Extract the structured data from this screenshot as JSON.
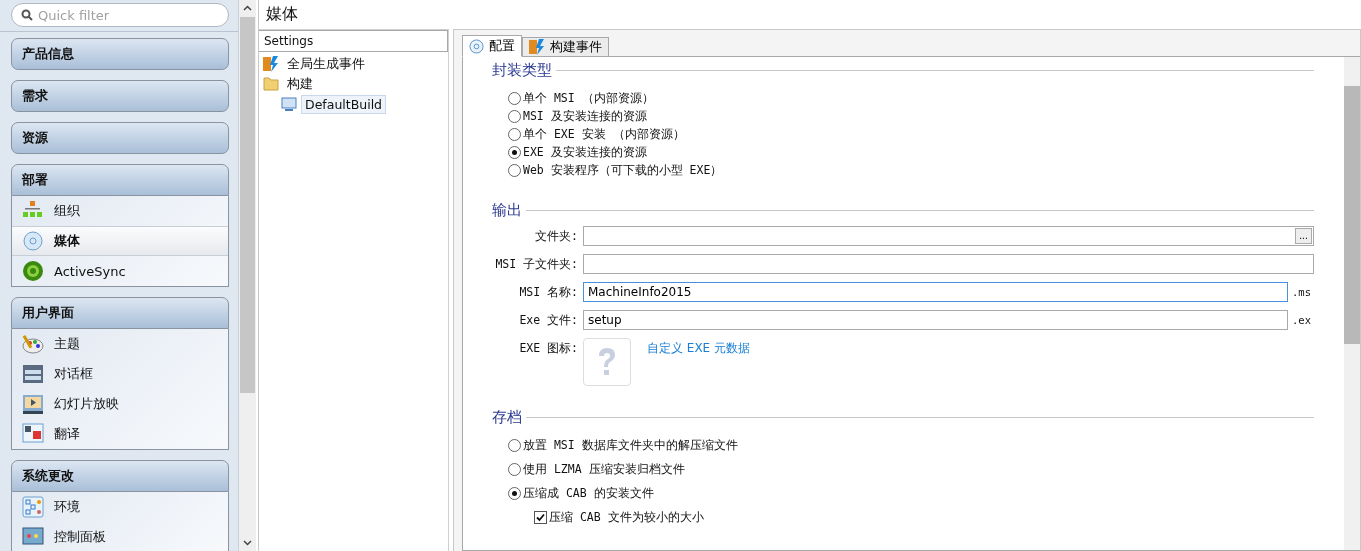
{
  "sidebar": {
    "search": {
      "placeholder": "Quick filter"
    },
    "groups": [
      {
        "title": "产品信息",
        "expanded": false
      },
      {
        "title": "需求",
        "expanded": false
      },
      {
        "title": "资源",
        "expanded": false
      },
      {
        "title": "部署",
        "expanded": true,
        "items": [
          {
            "label": "组织",
            "selected": false
          },
          {
            "label": "媒体",
            "selected": true
          },
          {
            "label": "ActiveSync",
            "selected": false
          }
        ]
      },
      {
        "title": "用户界面",
        "expanded": true,
        "items": [
          {
            "label": "主题",
            "selected": false
          },
          {
            "label": "对话框",
            "selected": false
          },
          {
            "label": "幻灯片放映",
            "selected": false
          },
          {
            "label": "翻译",
            "selected": false
          }
        ]
      },
      {
        "title": "系统更改",
        "expanded": true,
        "items": [
          {
            "label": "环境",
            "selected": false
          },
          {
            "label": "控制面板",
            "selected": false
          }
        ]
      }
    ]
  },
  "page_title": "媒体",
  "settings_tree": {
    "header": "Settings",
    "items": [
      {
        "label": "全局生成事件",
        "selected": false
      },
      {
        "label": "构建",
        "selected": false,
        "children": [
          {
            "label": "DefaultBuild",
            "selected": true
          }
        ]
      }
    ]
  },
  "tabs": [
    {
      "label": "配置",
      "selected": true
    },
    {
      "label": "构建事件",
      "selected": false
    }
  ],
  "sections": [
    {
      "title": "封装类型",
      "kind": "radios",
      "options": [
        {
          "label": "单个 MSI （内部资源）",
          "selected": false
        },
        {
          "label": "MSI 及安装连接的资源",
          "selected": false
        },
        {
          "label": "单个 EXE 安装 （内部资源）",
          "selected": false
        },
        {
          "label": "EXE 及安装连接的资源",
          "selected": true
        },
        {
          "label": "Web 安装程序（可下载的小型 EXE）",
          "selected": false
        }
      ]
    },
    {
      "title": "输出",
      "kind": "fields",
      "fields": [
        {
          "kind": "browse",
          "label": "文件夹:",
          "button": "...",
          "focused": false
        },
        {
          "kind": "text",
          "label": "MSI 子文件夹:",
          "focused": false
        },
        {
          "kind": "text",
          "label": "MSI 名称:",
          "value": "MachineInfo2015",
          "suffix": ".ms",
          "focused": true
        },
        {
          "kind": "text",
          "label": "Exe 文件:",
          "value": "setup",
          "suffix": ".ex",
          "focused": false
        },
        {
          "kind": "icon",
          "label": "EXE 图标:",
          "link": "自定义 EXE 元数据"
        }
      ]
    },
    {
      "title": "存档",
      "kind": "radios",
      "options": [
        {
          "label": "放置 MSI 数据库文件夹中的解压缩文件",
          "selected": false
        },
        {
          "label": "使用 LZMA 压缩安装归档文件",
          "selected": false
        },
        {
          "label": "压缩成 CAB 的安装文件",
          "selected": true,
          "checkbox": {
            "label": "压缩 CAB 文件为较小的大小",
            "checked": true
          }
        }
      ]
    }
  ]
}
